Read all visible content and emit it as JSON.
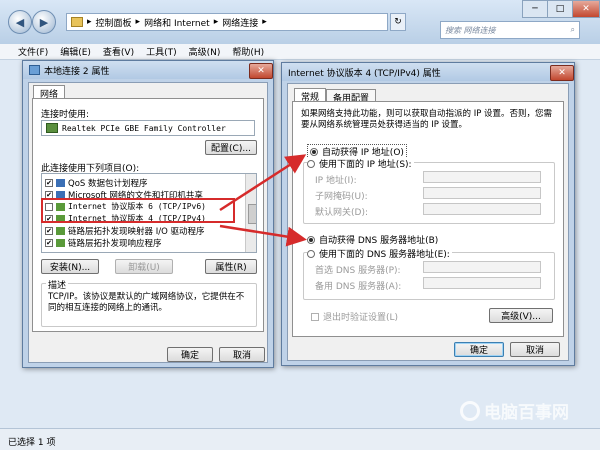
{
  "explorer": {
    "breadcrumb": [
      "控制面板",
      "网络和 Internet",
      "网络连接"
    ],
    "search_placeholder": "搜索 网络连接",
    "menu": [
      "文件(F)",
      "编辑(E)",
      "查看(V)",
      "工具(T)",
      "高级(N)",
      "帮助(H)"
    ],
    "status": "已选择 1 项"
  },
  "props": {
    "title": "本地连接 2 属性",
    "tab": "网络",
    "connect_using_label": "连接时使用:",
    "adapter": "Realtek PCIe GBE Family Controller",
    "configure_button": "配置(C)...",
    "items_label": "此连接使用下列项目(O):",
    "items": [
      {
        "label": "QoS 数据包计划程序",
        "checked": true
      },
      {
        "label": "Microsoft 网络的文件和打印机共享",
        "checked": true
      },
      {
        "label": "Internet 协议版本 6 (TCP/IPv6)",
        "checked": false
      },
      {
        "label": "Internet 协议版本 4 (TCP/IPv4)",
        "checked": true
      },
      {
        "label": "链路层拓扑发现映射器 I/O 驱动程序",
        "checked": true
      },
      {
        "label": "链路层拓扑发现响应程序",
        "checked": true
      }
    ],
    "install_button": "安装(N)...",
    "uninstall_button": "卸载(U)",
    "properties_button": "属性(R)",
    "desc_group": "描述",
    "desc_text": "TCP/IP。该协议是默认的广域网络协议，它提供在不同的相互连接的网络上的通讯。",
    "ok_button": "确定",
    "cancel_button": "取消"
  },
  "ipv4": {
    "title": "Internet 协议版本 4 (TCP/IPv4) 属性",
    "tabs": [
      "常规",
      "备用配置"
    ],
    "intro": "如果网络支持此功能，则可以获取自动指派的 IP 设置。否则，您需要从网络系统管理员处获得适当的 IP 设置。",
    "auto_ip": "自动获得 IP 地址(O)",
    "manual_ip": "使用下面的 IP 地址(S):",
    "ip_label": "IP 地址(I):",
    "mask_label": "子网掩码(U):",
    "gateway_label": "默认网关(D):",
    "auto_dns": "自动获得 DNS 服务器地址(B)",
    "manual_dns": "使用下面的 DNS 服务器地址(E):",
    "preferred_dns": "首选 DNS 服务器(P):",
    "alternate_dns": "备用 DNS 服务器(A):",
    "validate": "退出时验证设置(L)",
    "advanced_button": "高级(V)...",
    "ok_button": "确定",
    "cancel_button": "取消"
  },
  "watermark": "电脑百事网",
  "colors": {
    "highlight": "#d62b2b",
    "accent": "#3c7fb1"
  }
}
